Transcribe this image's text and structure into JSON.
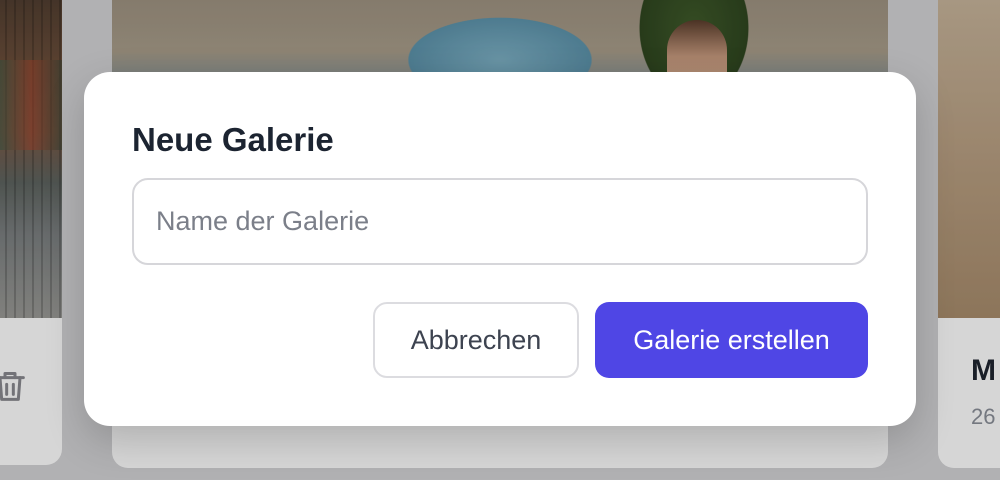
{
  "dialog": {
    "title": "Neue Galerie",
    "name_input": {
      "value": "",
      "placeholder": "Name der Galerie"
    },
    "cancel_label": "Abbrechen",
    "create_label": "Galerie erstellen"
  },
  "background": {
    "right_card": {
      "title_fragment": "M",
      "meta_fragment": "26"
    }
  },
  "colors": {
    "primary": "#4f46e5",
    "title_text": "#1c2431",
    "input_border": "#d6d6da",
    "placeholder": "#7b7f89"
  },
  "icons": {
    "left_card_action": "trash-icon"
  }
}
